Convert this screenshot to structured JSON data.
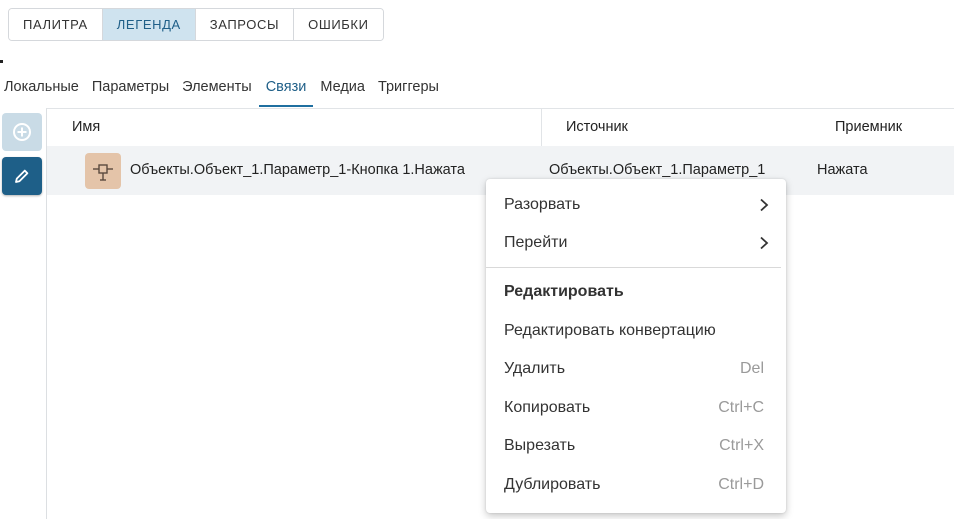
{
  "top_tabs": [
    {
      "label": "ПАЛИТРА",
      "active": false
    },
    {
      "label": "ЛЕГЕНДА",
      "active": true
    },
    {
      "label": "ЗАПРОСЫ",
      "active": false
    },
    {
      "label": "ОШИБКИ",
      "active": false
    }
  ],
  "sub_tabs": [
    {
      "label": "Локальные",
      "active": false
    },
    {
      "label": "Параметры",
      "active": false
    },
    {
      "label": "Элементы",
      "active": false
    },
    {
      "label": "Связи",
      "active": true
    },
    {
      "label": "Медиа",
      "active": false
    },
    {
      "label": "Триггеры",
      "active": false
    }
  ],
  "tools": {
    "add_icon": "add-circle-icon",
    "edit_icon": "pencil-icon"
  },
  "table": {
    "columns": {
      "name": "Имя",
      "source": "Источник",
      "receiver": "Приемник"
    },
    "rows": [
      {
        "icon": "connection-icon",
        "name": "Объекты.Объект_1.Параметр_1-Кнопка 1.Нажата",
        "source": "Объекты.Объект_1.Параметр_1",
        "receiver": "Нажата"
      }
    ]
  },
  "context_menu": {
    "items": [
      {
        "label": "Разорвать",
        "submenu": true
      },
      {
        "label": "Перейти",
        "submenu": true
      },
      {
        "label": "Редактировать",
        "bold": true
      },
      {
        "label": "Редактировать конвертацию"
      },
      {
        "label": "Удалить",
        "shortcut": "Del"
      },
      {
        "label": "Копировать",
        "shortcut": "Ctrl+C"
      },
      {
        "label": "Вырезать",
        "shortcut": "Ctrl+X"
      },
      {
        "label": "Дублировать",
        "shortcut": "Ctrl+D"
      }
    ]
  },
  "colors": {
    "accent": "#1e5f88",
    "active_tab_bg": "#cfe3ef",
    "row_icon_bg": "#e4c4a9"
  }
}
